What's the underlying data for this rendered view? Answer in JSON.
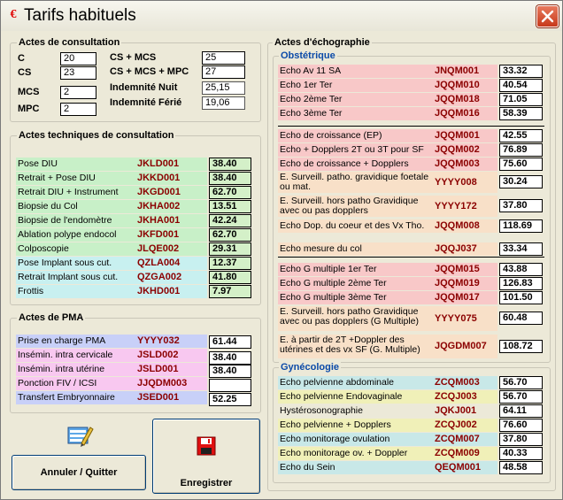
{
  "window": {
    "title": "Tarifs habituels"
  },
  "consult": {
    "title": "Actes de consultation",
    "left": [
      {
        "label": "C",
        "value": "20"
      },
      {
        "label": "CS",
        "value": "23"
      },
      {
        "label": "MCS",
        "value": "2"
      },
      {
        "label": "MPC",
        "value": "2"
      }
    ],
    "right": [
      {
        "label": "CS + MCS",
        "value": "25"
      },
      {
        "label": "CS + MCS + MPC",
        "value": "27"
      },
      {
        "label": "Indemnité Nuit",
        "value": "25,15"
      },
      {
        "label": "Indemnité Férié",
        "value": "19,06"
      }
    ]
  },
  "tech": {
    "title": "Actes techniques de consultation",
    "rows": [
      {
        "name": "Pose DIU",
        "code": "JKLD001",
        "value": "38.40",
        "bg": "#c8f0c8"
      },
      {
        "name": "Retrait + Pose DIU",
        "code": "JKKD001",
        "value": "38.40",
        "bg": "#c8f0c8"
      },
      {
        "name": "Retrait DIU + Instrument",
        "code": "JKGD001",
        "value": "62.70",
        "bg": "#c8f0c8"
      },
      {
        "name": "Biopsie du Col",
        "code": "JKHA002",
        "value": "13.51",
        "bg": "#c8f0c8"
      },
      {
        "name": "Biopsie de l'endomètre",
        "code": "JKHA001",
        "value": "42.24",
        "bg": "#c8f0c8"
      },
      {
        "name": "Ablation polype endocol",
        "code": "JKFD001",
        "value": "62.70",
        "bg": "#c8f0c8"
      },
      {
        "name": "Colposcopie",
        "code": "JLQE002",
        "value": "29.31",
        "bg": "#c8f0c8"
      },
      {
        "name": "Pose Implant sous cut.",
        "code": "QZLA004",
        "value": "12.37",
        "bg": "#c8f0f0"
      },
      {
        "name": "Retrait Implant sous cut.",
        "code": "QZGA002",
        "value": "41.80",
        "bg": "#c8f0f0"
      },
      {
        "name": "Frottis",
        "code": "JKHD001",
        "value": "7.97",
        "bg": "#c8f0f0"
      }
    ]
  },
  "pma": {
    "title": "Actes de PMA",
    "rows": [
      {
        "name": "Prise en charge PMA",
        "code": "YYYY032",
        "value": "61.44",
        "bg": "#c8d0f8"
      },
      {
        "name": "Insémin. intra cervicale",
        "code": "JSLD002",
        "value": "38.40",
        "bg": "#f8c8f0"
      },
      {
        "name": "Insémin. intra utérine",
        "code": "JSLD001",
        "value": "38.40",
        "bg": "#f8c8f0"
      },
      {
        "name": "Ponction FIV / ICSI",
        "code": "JJQDM003",
        "value": "",
        "bg": "#f8c8f0"
      },
      {
        "name": "Transfert Embryonnaire",
        "code": "JSED001",
        "value": "52.25",
        "bg": "#c8d0f8"
      }
    ]
  },
  "echo": {
    "title": "Actes d'échographie",
    "obst_title": "Obstétrique",
    "gyn_title": "Gynécologie",
    "obst": [
      {
        "name": "Echo Av 11 SA",
        "code": "JNQM001",
        "value": "33.32",
        "bg": "#f8c8c8"
      },
      {
        "name": "Echo 1er Ter",
        "code": "JQQM010",
        "value": "40.54",
        "bg": "#f8c8c8"
      },
      {
        "name": "Echo 2ème Ter",
        "code": "JQQM018",
        "value": "71.05",
        "bg": "#f8c8c8"
      },
      {
        "name": "Echo 3ème Ter",
        "code": "JQQM016",
        "value": "58.39",
        "bg": "#f8c8c8"
      },
      {
        "name": "Echo de croissance (EP)",
        "code": "JQQM001",
        "value": "42.55",
        "bg": "#f8c8c8"
      },
      {
        "name": "Echo + Dopplers 2T ou 3T pour SF",
        "code": "JQQM002",
        "value": "76.89",
        "bg": "#f8c8c8"
      },
      {
        "name": "Echo de croissance + Dopplers",
        "code": "JQQM003",
        "value": "75.60",
        "bg": "#f8c8c8"
      },
      {
        "name": "E. Surveill. patho. gravidique foetale ou mat.",
        "code": "YYYY008",
        "value": "30.24",
        "bg": "#f8e0c8"
      },
      {
        "name": "E. Surveill. hors patho Gravidique avec ou pas dopplers",
        "code": "YYYY172",
        "value": "37.80",
        "bg": "#f8e0c8"
      },
      {
        "name": "Echo Dop. du coeur et des Vx Tho.",
        "code": "JQQM008",
        "value": "118.69",
        "bg": "#f8e0c8"
      },
      {
        "name": "Echo mesure du col",
        "code": "JQQJ037",
        "value": "33.34",
        "bg": "#f8e0c8"
      },
      {
        "name": "Echo G multiple 1er Ter",
        "code": "JQQM015",
        "value": "43.88",
        "bg": "#f8c8c8"
      },
      {
        "name": "Echo G multiple 2ème Ter",
        "code": "JQQM019",
        "value": "126.83",
        "bg": "#f8c8c8"
      },
      {
        "name": "Echo G multiple 3ème Ter",
        "code": "JQQM017",
        "value": "101.50",
        "bg": "#f8c8c8"
      },
      {
        "name": "E. Surveill. hors patho Gravidique avec ou pas dopplers (G Multiple)",
        "code": "YYYY075",
        "value": "60.48",
        "bg": "#f8e0c8"
      },
      {
        "name": "E. à partir de 2T +Doppler des utérines et des vx SF (G. Multiple)",
        "code": "JQGDM007",
        "value": "108.72",
        "bg": "#f8e0c8"
      }
    ],
    "gyn": [
      {
        "name": "Echo pelvienne abdominale",
        "code": "ZCQM003",
        "value": "56.70",
        "bg": "#c8e8e8"
      },
      {
        "name": "Echo pelvienne Endovaginale",
        "code": "ZCQJ003",
        "value": "56.70",
        "bg": "#f0f0b8"
      },
      {
        "name": "Hystérosonographie",
        "code": "JQKJ001",
        "value": "64.11",
        "bg": "#ece9d8"
      },
      {
        "name": "Echo pelvienne + Dopplers",
        "code": "ZCQJ002",
        "value": "76.60",
        "bg": "#f0f0b8"
      },
      {
        "name": "Echo monitorage ovulation",
        "code": "ZCQM007",
        "value": "37.80",
        "bg": "#c8e8e8"
      },
      {
        "name": "Echo monitorage ov. + Doppler",
        "code": "ZCQM009",
        "value": "40.33",
        "bg": "#f0f0b8"
      },
      {
        "name": "Echo du Sein",
        "code": "QEQM001",
        "value": "48.58",
        "bg": "#c8e8e8"
      }
    ]
  },
  "buttons": {
    "cancel": "Annuler / Quitter",
    "save": "Enregistrer"
  },
  "colors": {
    "code": "#8b0000"
  }
}
